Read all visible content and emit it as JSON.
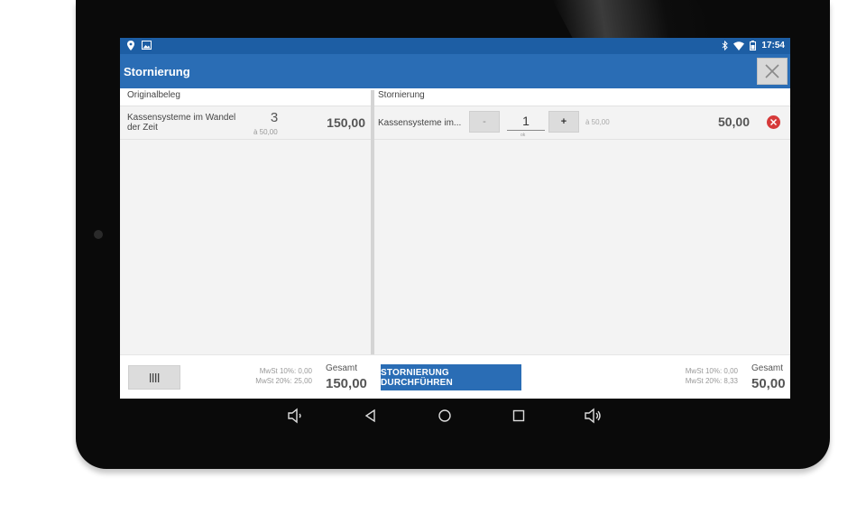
{
  "status_bar": {
    "time": "17:54",
    "left_icons": [
      "location-pin-icon",
      "image-icon"
    ],
    "right_icons": [
      "bluetooth-icon",
      "wifi-icon",
      "battery-icon"
    ]
  },
  "app_bar": {
    "title": "Stornierung",
    "close_icon": "close-icon"
  },
  "left_panel": {
    "header": "Originalbeleg",
    "items": [
      {
        "name": "Kassensysteme im Wandel der Zeit",
        "quantity": "3",
        "unit_price": "à 50,00",
        "total": "150,00"
      }
    ]
  },
  "right_panel": {
    "header": "Stornierung",
    "items": [
      {
        "name": "Kassensysteme im...",
        "minus_label": "-",
        "quantity": "1",
        "quantity_sub": "ok",
        "plus_label": "+",
        "unit_price": "à 50,00",
        "total": "50,00"
      }
    ]
  },
  "footer": {
    "left": {
      "vat_10": "MwSt 10%: 0,00",
      "vat_20": "MwSt 20%: 25,00",
      "total_label": "Gesamt",
      "total_value": "150,00"
    },
    "action_button": "STORNIERUNG DURCHFÜHREN",
    "right": {
      "vat_10": "MwSt 10%: 0,00",
      "vat_20": "MwSt 20%: 8,33",
      "total_label": "Gesamt",
      "total_value": "50,00"
    }
  },
  "colors": {
    "status_bar": "#1d5ea4",
    "app_bar": "#2a6db5",
    "action_button": "#2a6db5",
    "remove_button": "#d63a3a"
  }
}
